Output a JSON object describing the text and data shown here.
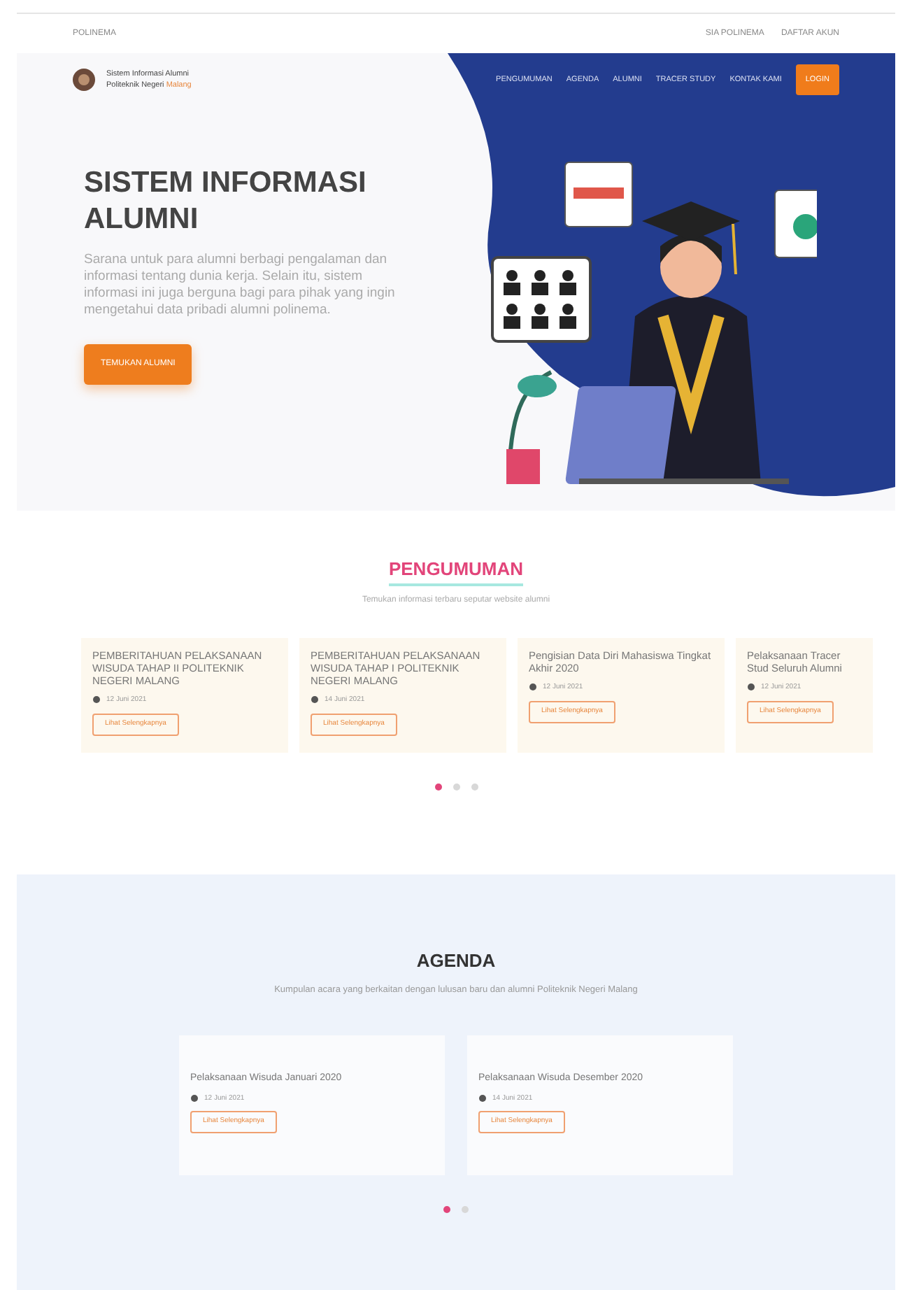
{
  "topbar": {
    "left": "POLINEMA",
    "links": [
      "SIA POLINEMA",
      "DAFTAR AKUN"
    ]
  },
  "brand": {
    "line1": "Sistem Informasi Alumni",
    "line2": "Politeknik Negeri",
    "highlight": "Malang"
  },
  "nav": [
    {
      "label": "PENGUMUMAN",
      "kind": "link"
    },
    {
      "label": "AGENDA",
      "kind": "link"
    },
    {
      "label": "ALUMNI",
      "kind": "link"
    },
    {
      "label": "TRACER STUDY",
      "kind": "link"
    },
    {
      "label": "KONTAK KAMI",
      "kind": "link"
    },
    {
      "label": "LOGIN",
      "kind": "button"
    }
  ],
  "hero": {
    "title": "SISTEM INFORMASI ALUMNI",
    "text": "Sarana untuk para alumni berbagi pengalaman dan informasi tentang dunia kerja. Selain itu, sistem informasi ini juga berguna bagi para pihak yang ingin mengetahui data pribadi alumni polinema.",
    "button": "TEMUKAN ALUMNI"
  },
  "announcements": {
    "title": "PENGUMUMAN",
    "subtitle": "Temukan informasi terbaru seputar website alumni",
    "items": [
      {
        "title": "PEMBERITAHUAN PELAKSANAAN WISUDA TAHAP II POLITEKNIK NEGERI MALANG",
        "date": "12 Juni 2021",
        "button": "Lihat Selengkapnya"
      },
      {
        "title": "PEMBERITAHUAN PELAKSANAAN WISUDA TAHAP I POLITEKNIK NEGERI MALANG",
        "date": "14 Juni 2021",
        "button": "Lihat Selengkapnya"
      },
      {
        "title": "Pengisian Data Diri Mahasiswa Tingkat Akhir 2020",
        "date": "12 Juni 2021",
        "button": "Lihat Selengkapnya"
      },
      {
        "title": "Pelaksanaan Tracer Stud Seluruh Alumni",
        "date": "12 Juni 2021",
        "button": "Lihat Selengkapnya"
      }
    ],
    "dots": [
      {
        "selected": true
      },
      {
        "selected": false
      },
      {
        "selected": false
      }
    ]
  },
  "agenda": {
    "title": "AGENDA",
    "subtitle": "Kumpulan acara yang berkaitan dengan lulusan baru dan alumni Politeknik Negeri Malang",
    "items": [
      {
        "title": "Pelaksanaan Wisuda Januari 2020",
        "date": "12 Juni 2021",
        "button": "Lihat Selengkapnya"
      },
      {
        "title": "Pelaksanaan Wisuda Desember 2020",
        "date": "14 Juni 2021",
        "button": "Lihat Selengkapnya"
      }
    ],
    "dots": [
      {
        "selected": true
      },
      {
        "selected": false
      }
    ]
  }
}
